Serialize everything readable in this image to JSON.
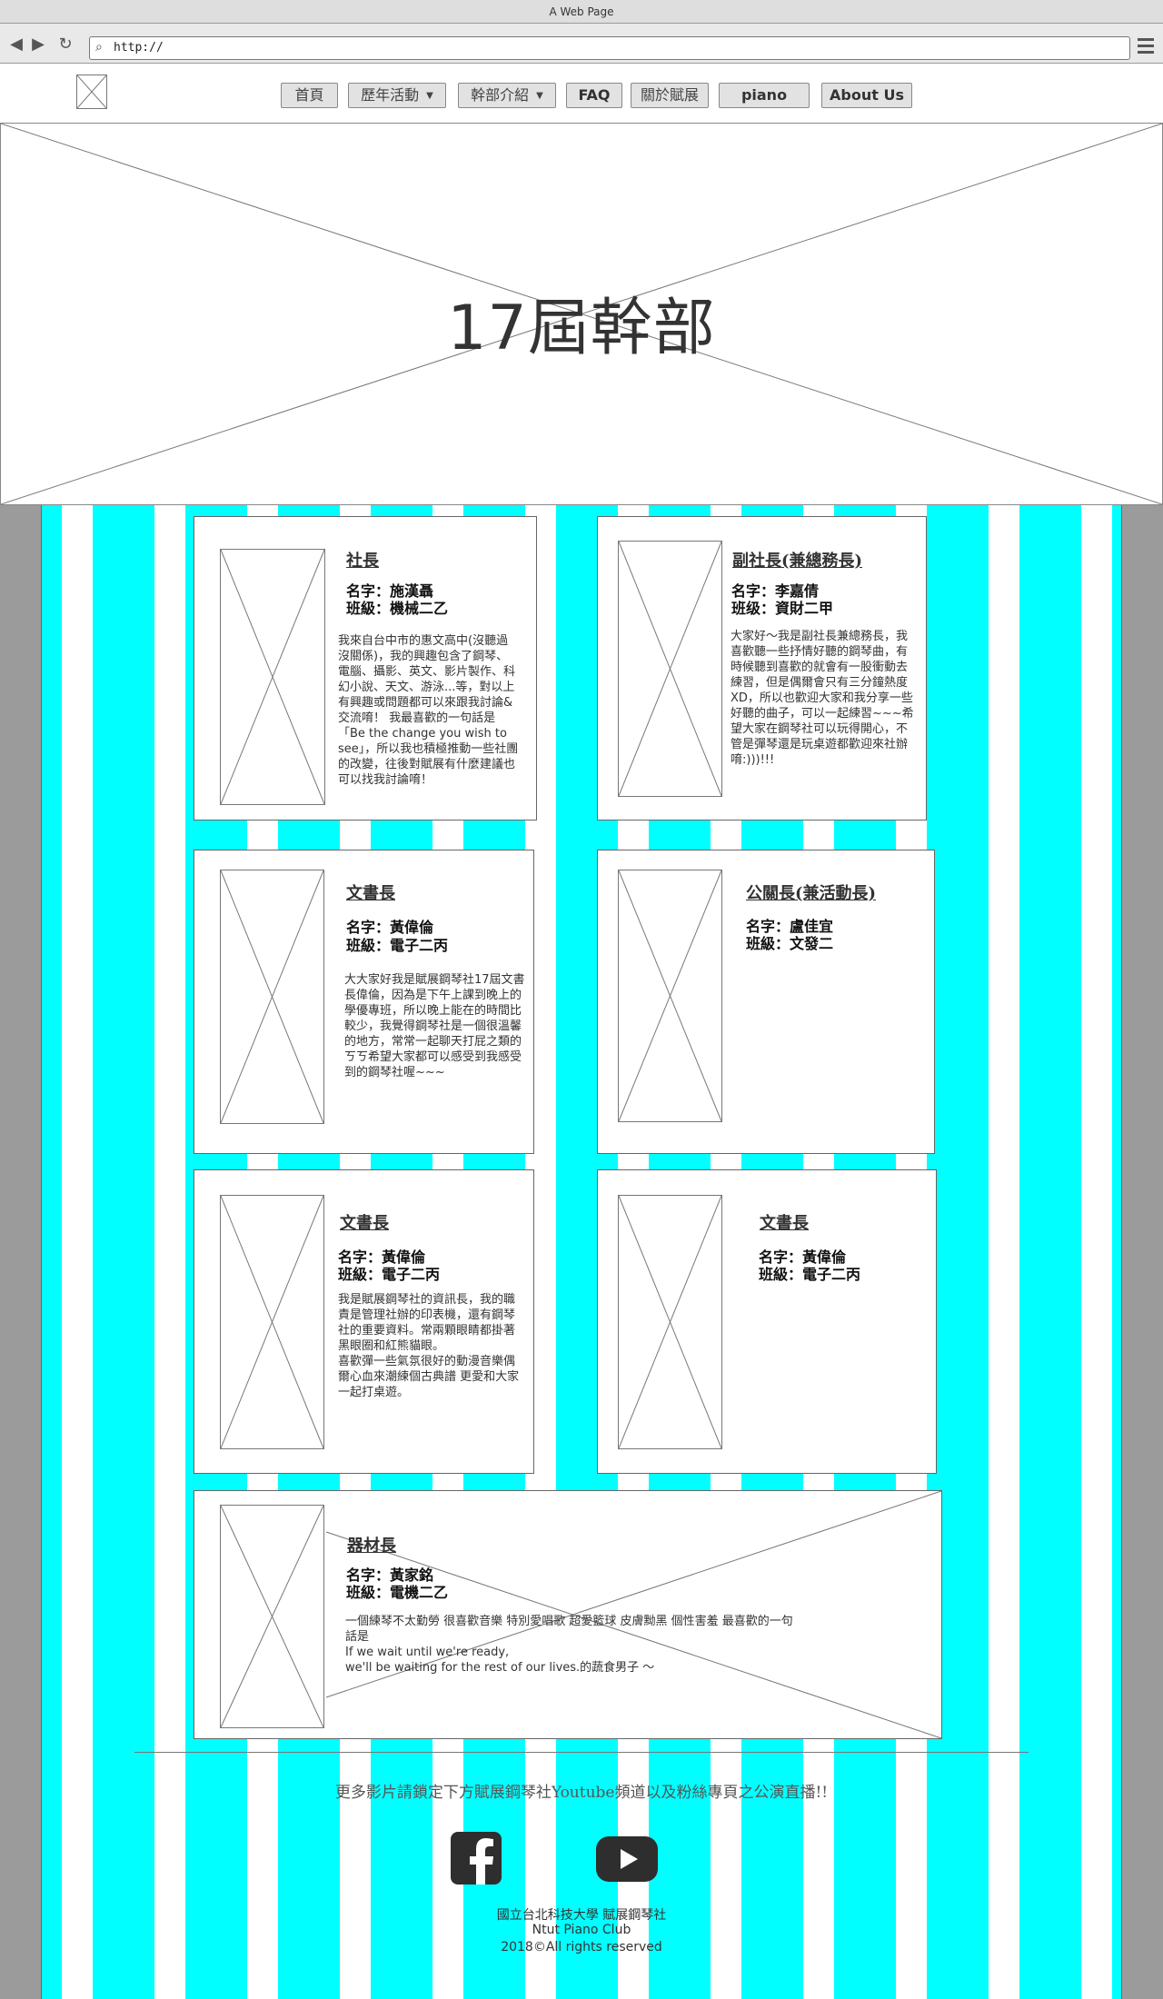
{
  "browser": {
    "window_title": "A Web Page",
    "url": "http://"
  },
  "nav": {
    "items": [
      {
        "label": "首頁"
      },
      {
        "label": "歷年活動"
      },
      {
        "label": "幹部介紹"
      },
      {
        "label": "FAQ"
      },
      {
        "label": "關於賦展"
      },
      {
        "label": "piano"
      },
      {
        "label": "About Us"
      }
    ]
  },
  "hero": {
    "title": "17屆幹部"
  },
  "cards": [
    {
      "role": "社長",
      "name": "名字：施漢聶",
      "class": "班級：機械二乙",
      "desc": "我來自台中市的惠文高中(沒聽過沒關係)，我的興趣包含了鋼琴、電腦、攝影、英文、影片製作、科幻小說、天文、游泳...等，對以上有興趣或問題都可以來跟我討論&交流唷！ 我最喜歡的一句話是「Be the change you wish to see」，所以我也積極推動一些社團的改變，往後對賦展有什麼建議也可以找我討論唷！"
    },
    {
      "role": "副社長(兼總務長)",
      "name": "名字：李嘉倩",
      "class": "班级：資財二甲",
      "desc": "大家好～我是副社長兼總務長，我喜歡聽一些抒情好聽的鋼琴曲，有時候聽到喜歡的就會有一股衝動去練習，但是偶爾會只有三分鐘熱度XD，所以也歡迎大家和我分享一些好聽的曲子，可以一起練習~~~希望大家在鋼琴社可以玩得開心，不管是彈琴還是玩桌遊都歡迎來社辦唷:)))!!!"
    },
    {
      "role": "文書長",
      "name": "名字：黃偉倫",
      "class": "班級：電子二丙",
      "desc": "大大家好我是賦展鋼琴社17屆文書長偉倫，因為是下午上課到晚上的學優專班，所以晚上能在的時間比較少，我覺得鋼琴社是一個很溫馨的地方，常常一起聊天打屁之類的ㄎㄎ希望大家都可以感受到我感受到的鋼琴社喔~~~"
    },
    {
      "role": "公關長(兼活動長)",
      "name": "名字：盧佳宜",
      "class": "班級：文發二",
      "desc": ""
    },
    {
      "role": "文書長",
      "name": "名字：黃偉倫",
      "class": "班級：電子二丙",
      "desc": "我是賦展鋼琴社的資訊長，我的職責是管理社辦的印表機，還有鋼琴社的重要資料。常兩顆眼睛都掛著黑眼圈和紅熊貓眼。\n喜歡彈一些氣氛很好的動漫音樂偶爾心血來潮練個古典譜 更愛和大家一起打桌遊。"
    },
    {
      "role": "文書長",
      "name": "名字：黃偉倫",
      "class": "班級：電子二丙",
      "desc": ""
    },
    {
      "role": "器材長",
      "name": "名字：黃家銘",
      "class": "班級：電機二乙",
      "desc": "一個練琴不太勤勞 很喜歡音樂 特別愛唱歌 超愛籃球 皮膚黝黑 個性害羞 最喜歡的一句話是\nIf we wait until we're ready,\nwe'll be waiting for the rest of our lives.的蔬食男子 ～"
    }
  ],
  "footer": {
    "promo": "更多影片請鎖定下方賦展鋼琴社Youtube頻道以及粉絲專頁之公演直播!!",
    "credit1": "國立台北科技大學 賦展鋼琴社",
    "credit2": "Ntut Piano Club",
    "credit3": "2018©All rights reserved",
    "facebook_icon": "facebook-icon",
    "youtube_icon": "youtube-icon"
  }
}
